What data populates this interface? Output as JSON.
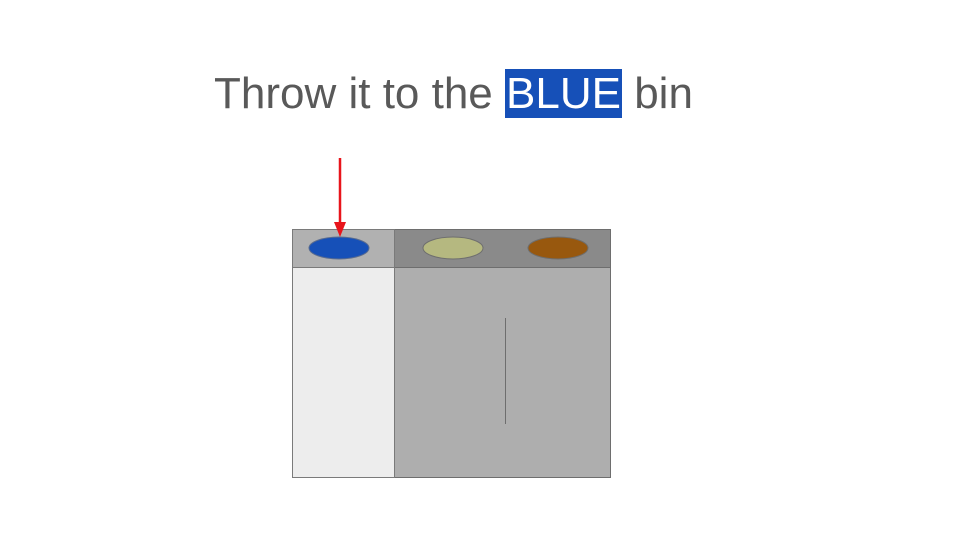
{
  "instruction": {
    "before": "Throw it to the ",
    "highlight": "BLUE",
    "after": " bin"
  },
  "colors": {
    "text": "#595959",
    "highlight_bg": "#1650B8",
    "highlight_text": "#ffffff",
    "arrow": "#E8141B",
    "blue_bin_lid": "#1650B8",
    "khaki_bin_lid": "#B5B880",
    "brown_bin_lid": "#98580E",
    "selected_bin_top": "#B1B1B1",
    "selected_bin_body": "#EDEDED",
    "other_bins_top": "#8A8A8A",
    "other_bins_body": "#AEAEAE"
  },
  "bins": [
    {
      "name": "blue",
      "selected": true
    },
    {
      "name": "khaki",
      "selected": false
    },
    {
      "name": "brown",
      "selected": false
    }
  ],
  "target_bin": "blue"
}
